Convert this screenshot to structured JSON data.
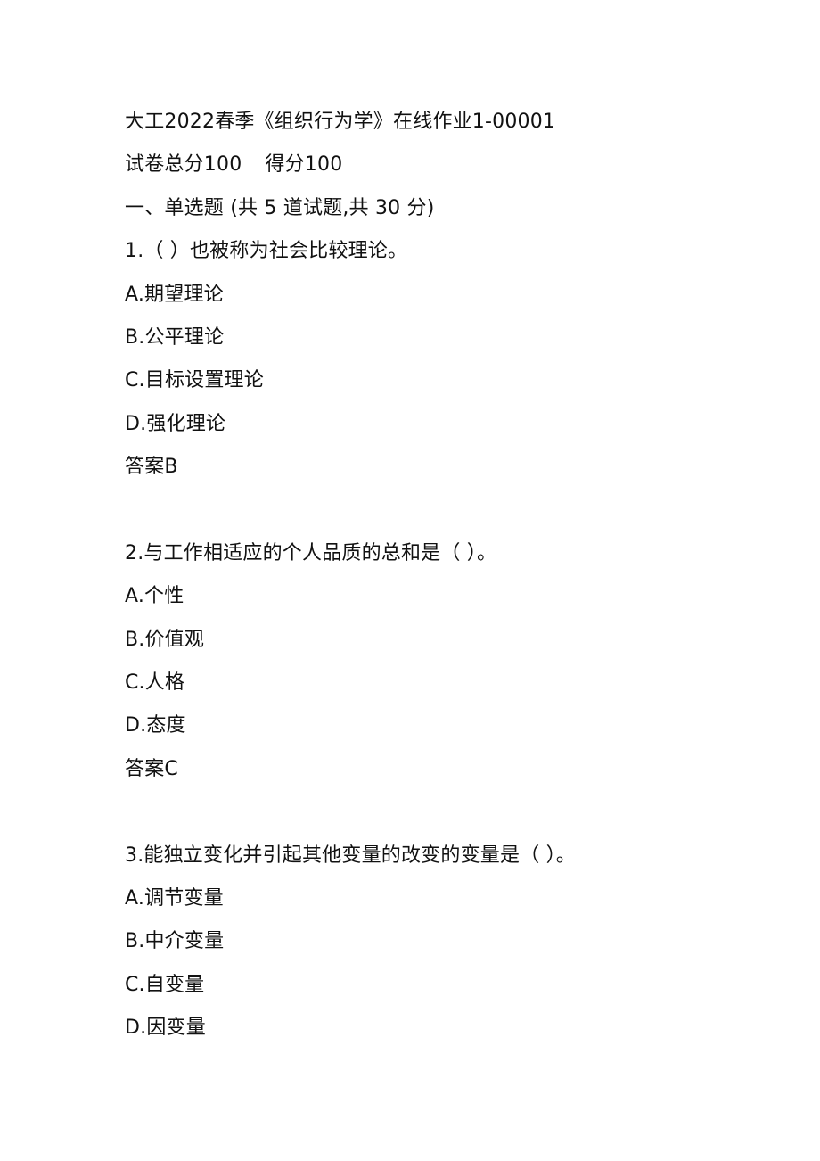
{
  "document": {
    "title": "大工2022春季《组织行为学》在线作业1-00001",
    "score_line": {
      "total_label": "试卷总分100",
      "score_label": "得分100"
    },
    "section": "一、单选题 (共 5 道试题,共 30 分)",
    "questions": [
      {
        "stem": "1.（ ）也被称为社会比较理论。",
        "options": [
          "A.期望理论",
          "B.公平理论",
          "C.目标设置理论",
          "D.强化理论"
        ],
        "answer": "答案B"
      },
      {
        "stem": "2.与工作相适应的个人品质的总和是（ ）。",
        "options": [
          "A.个性",
          "B.价值观",
          "C.人格",
          "D.态度"
        ],
        "answer": "答案C"
      },
      {
        "stem": "3.能独立变化并引起其他变量的改变的变量是（ ）。",
        "options": [
          "A.调节变量",
          "B.中介变量",
          "C.自变量",
          "D.因变量"
        ],
        "answer": null
      }
    ]
  }
}
